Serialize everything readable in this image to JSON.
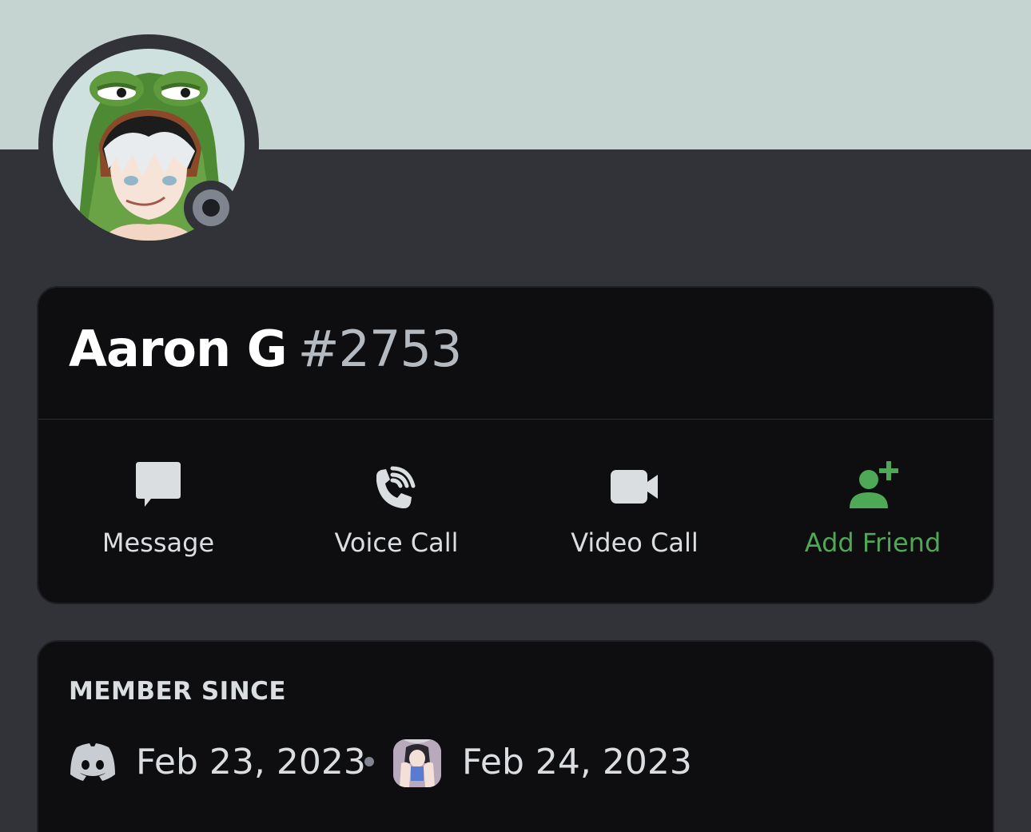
{
  "profile": {
    "display_name": "Aaron G",
    "discriminator": "#2753",
    "status": "offline",
    "banner_color": "#c6d4d1"
  },
  "actions": [
    {
      "label": "Message",
      "icon": "message-icon",
      "color": "#dbdee1"
    },
    {
      "label": "Voice Call",
      "icon": "phone-icon",
      "color": "#dbdee1"
    },
    {
      "label": "Video Call",
      "icon": "video-camera-icon",
      "color": "#dbdee1"
    },
    {
      "label": "Add Friend",
      "icon": "add-friend-icon",
      "color": "#4fa855"
    }
  ],
  "member_since": {
    "title": "MEMBER SINCE",
    "discord_date": "Feb 23, 2023",
    "server_date": "Feb 24, 2023"
  }
}
